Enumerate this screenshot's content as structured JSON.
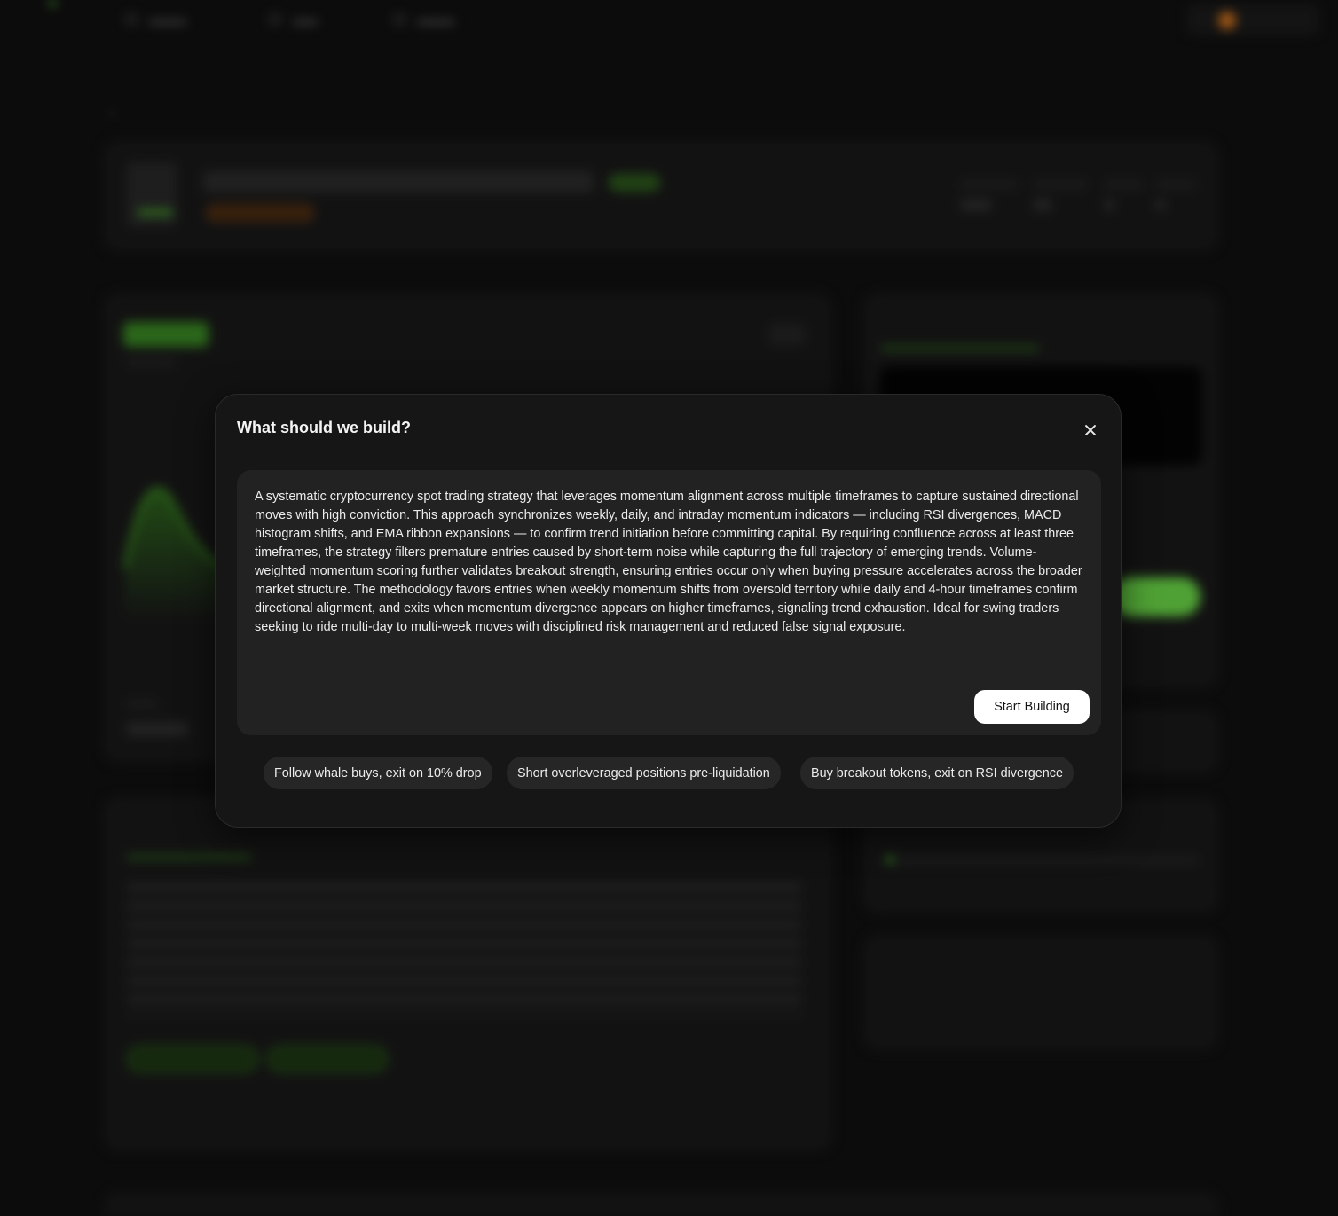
{
  "modal": {
    "title": "What should we build?",
    "prompt_text": "A systematic cryptocurrency spot trading strategy that leverages momentum alignment across multiple timeframes to capture sustained directional moves with high conviction. This approach synchronizes weekly, daily, and intraday momentum indicators — including RSI divergences, MACD histogram shifts, and EMA ribbon expansions — to confirm trend initiation before committing capital. By requiring confluence across at least three timeframes, the strategy filters premature entries caused by short-term noise while capturing the full trajectory of emerging trends. Volume-weighted momentum scoring further validates breakout strength, ensuring entries occur only when buying pressure accelerates across the broader market structure. The methodology favors entries when weekly momentum shifts from oversold territory while daily and 4-hour timeframes confirm directional alignment, and exits when momentum divergence appears on higher timeframes, signaling trend exhaustion. Ideal for swing traders seeking to ride multi-day to multi-week moves with disciplined risk management and reduced false signal exposure.",
    "start_button": "Start Building",
    "suggestions": [
      "Follow whale buys, exit on 10% drop",
      "Short overleveraged positions pre-liquidation",
      "Buy breakout tokens, exit on RSI divergence"
    ]
  },
  "colors": {
    "accent_green": "#5cd63a",
    "modal_bg": "#161616",
    "prompt_bg": "#222222",
    "button_bg": "#ffffff"
  },
  "icons": {
    "close": "close-icon"
  }
}
